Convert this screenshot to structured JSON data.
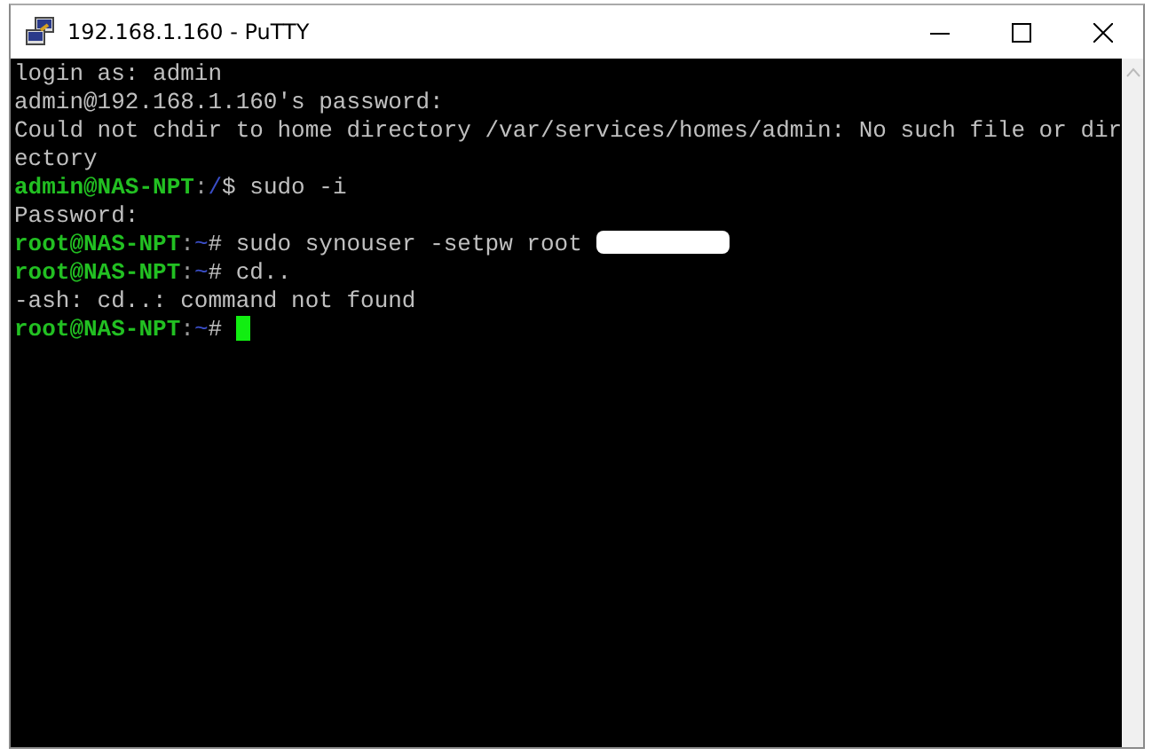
{
  "window": {
    "title": "192.168.1.160 - PuTTY"
  },
  "terminal": {
    "lines": [
      [
        {
          "kind": "text",
          "text": "login as: admin"
        }
      ],
      [
        {
          "kind": "text",
          "text": "admin@192.168.1.160's password:"
        }
      ],
      [
        {
          "kind": "text",
          "text": "Could not chdir to home directory /var/services/homes/admin: No such file or dir"
        }
      ],
      [
        {
          "kind": "text",
          "text": "ectory"
        }
      ],
      [
        {
          "kind": "prompt",
          "text": "admin@NAS-NPT"
        },
        {
          "kind": "sep",
          "text": ":"
        },
        {
          "kind": "path",
          "text": "/"
        },
        {
          "kind": "text",
          "text": "$ sudo -i"
        }
      ],
      [
        {
          "kind": "text",
          "text": "Password:"
        }
      ],
      [
        {
          "kind": "prompt",
          "text": "root@NAS-NPT"
        },
        {
          "kind": "sep",
          "text": ":"
        },
        {
          "kind": "path",
          "text": "~"
        },
        {
          "kind": "text",
          "text": "# sudo synouser -setpw root "
        },
        {
          "kind": "redaction"
        }
      ],
      [
        {
          "kind": "prompt",
          "text": "root@NAS-NPT"
        },
        {
          "kind": "sep",
          "text": ":"
        },
        {
          "kind": "path",
          "text": "~"
        },
        {
          "kind": "text",
          "text": "# cd.."
        }
      ],
      [
        {
          "kind": "text",
          "text": "-ash: cd..: command not found"
        }
      ],
      [
        {
          "kind": "prompt",
          "text": "root@NAS-NPT"
        },
        {
          "kind": "sep",
          "text": ":"
        },
        {
          "kind": "path",
          "text": "~"
        },
        {
          "kind": "text",
          "text": "# "
        },
        {
          "kind": "cursor"
        }
      ]
    ]
  }
}
